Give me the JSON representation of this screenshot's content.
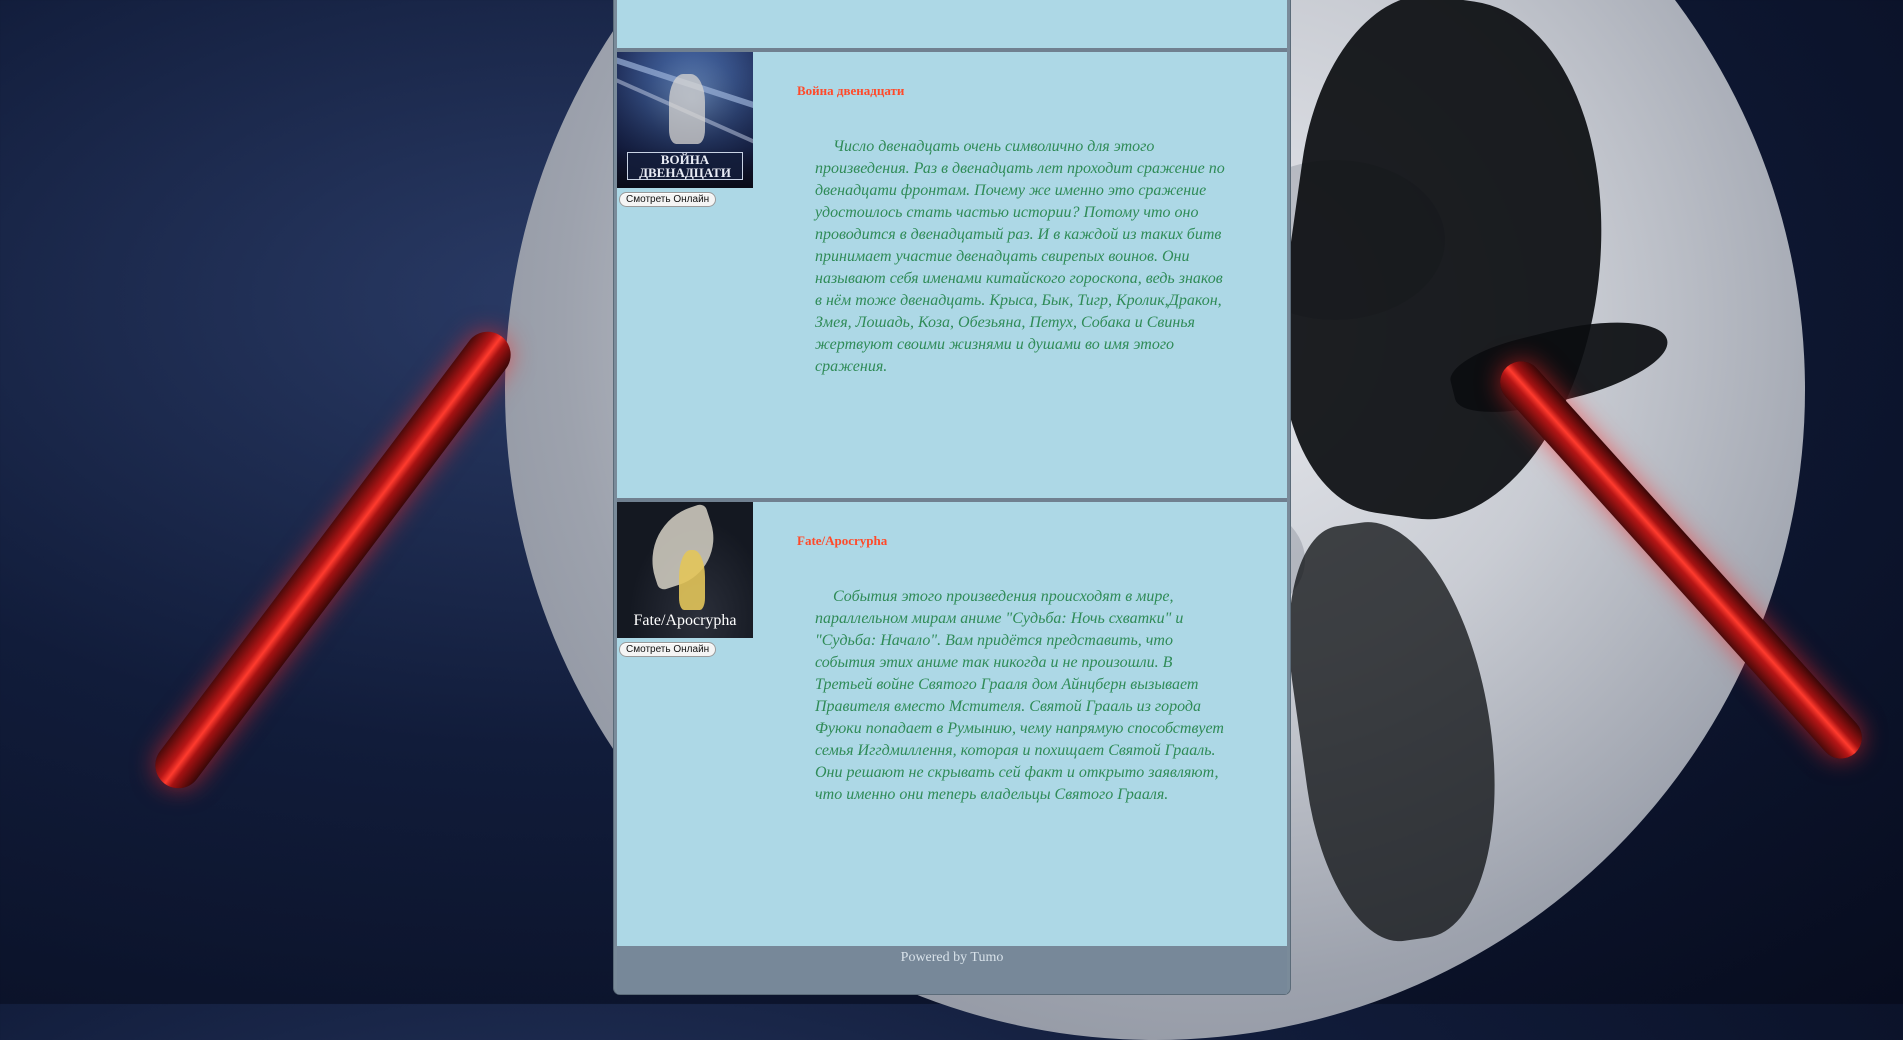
{
  "entries": [
    {
      "title": "Война двенадцати",
      "poster_caption": "ВОЙНА ДВЕНАДЦАТИ",
      "watch_label": "Смотреть Онлайн",
      "description": "Число двенадцать очень символично для этого произведения. Раз в двенадцать лет проходит сражение по двенадцати фронтам. Почему же именно это сражение удостоилось стать частью истории? Потому что оно проводится в двенадцатый раз. И в каждой из таких битв принимает участие двенадцать свирепых воинов. Они называют себя именами китайского гороскопа, ведь знаков в нём тоже двенадцать. Крыса, Бык, Тигр, Кролик,Дракон, Змея, Лошадь, Коза, Обезьяна, Петух, Собака и Свинья жертвуют своими жизнями и душами во имя этого сражения."
    },
    {
      "title": "Fate/Apocrypha",
      "poster_caption": "Fate/Apocrypha",
      "watch_label": "Смотреть Онлайн",
      "description": "События этого произведения происходят в мире, параллельном мирам аниме \"Судьба: Ночь схватки\" и \"Судьба: Начало\". Вам придётся представить, что события этих аниме так никогда и не произошли. В Третьей войне Святого Грааля дом Айнцберн вызывает Правителя вместо Мстителя. Святой Грааль из города Фуюки попадает в Румынию, чему напрямую способствует семья Иггдмиллення, которая и похищает Святой Грааль. Они решают не скрывать сей факт и открыто заявляют, что именно они теперь владельцы Святого Грааля."
    }
  ],
  "footer": {
    "text": "Powered by Tumo"
  },
  "colors": {
    "panel": "#add8e6",
    "divider": "#708090",
    "footer": "#778899",
    "title": "#ff4a2a",
    "text": "#2f8b57"
  }
}
